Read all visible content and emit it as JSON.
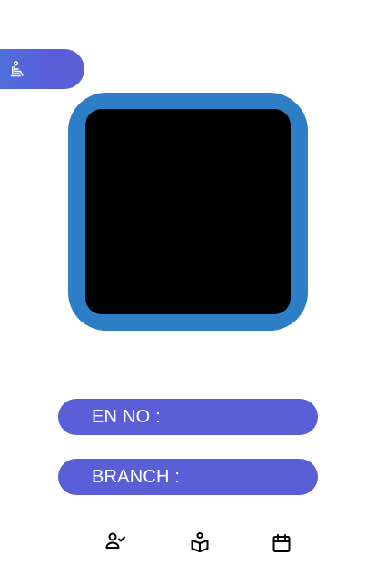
{
  "top_tab": {
    "icon": "seated-person-icon"
  },
  "photo": {
    "frame_color": "#2d7ec7",
    "inner_color": "#000000"
  },
  "fields": {
    "en_no_label": "EN NO :",
    "branch_label": "BRANCH :"
  },
  "bottom_nav": {
    "items": [
      {
        "icon": "person-check-icon"
      },
      {
        "icon": "reading-person-icon"
      },
      {
        "icon": "calendar-icon"
      }
    ]
  },
  "colors": {
    "accent": "#5a5fd8",
    "frame": "#2d7ec7",
    "background": "#ffffff"
  }
}
